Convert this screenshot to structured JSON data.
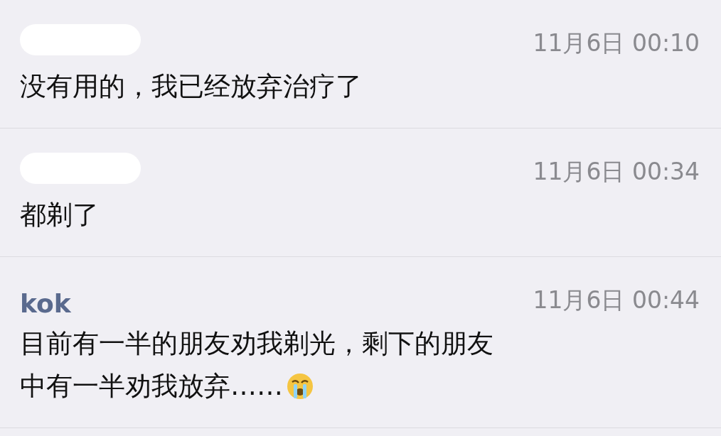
{
  "messages": [
    {
      "name_obscured": true,
      "time": "11月6日 00:10",
      "lines": [
        "没有用的，我已经放弃治疗了"
      ],
      "emoji": false
    },
    {
      "name_obscured": true,
      "time": "11月6日 00:34",
      "lines": [
        "都剃了"
      ],
      "emoji": false
    },
    {
      "name_obscured": false,
      "name": "kok",
      "time": "11月6日 00:44",
      "lines": [
        "目前有一半的朋友劝我剃光，剩下的朋友",
        "中有一半劝我放弃……"
      ],
      "emoji": true
    }
  ]
}
